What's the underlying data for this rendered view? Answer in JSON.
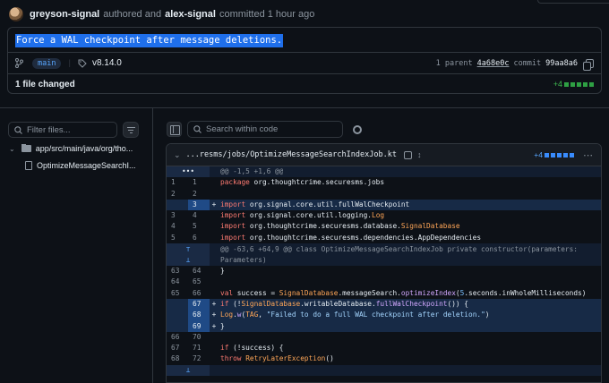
{
  "commit": {
    "author": "greyson-signal",
    "authored_text": "authored and",
    "committer": "alex-signal",
    "committed_text": "committed 1 hour ago",
    "message": "Force a WAL checkpoint after message deletions.",
    "branch": "main",
    "tag": "v8.14.0",
    "parent_text": "1 parent",
    "parent_sha": "4a68e0c",
    "commit_text": "commit",
    "commit_sha": "99aa8a6",
    "files_changed": "1 file changed",
    "additions": "+4"
  },
  "sidebar": {
    "filter_placeholder": "Filter files...",
    "dir_path": "app/src/main/java/org/tho...",
    "file_name": "OptimizeMessageSearchI..."
  },
  "toolbar": {
    "search_placeholder": "Search within code"
  },
  "diff": {
    "file_path": "...resms/jobs/OptimizeMessageSearchIndexJob.kt",
    "additions": "+4",
    "hunk1": "@@ -1,5 +1,6 @@",
    "hunk2_line1": "@@ -63,6 +64,9 @@ class OptimizeMessageSearchIndexJob private constructor(parameters:",
    "hunk2_line2": "Parameters)",
    "lines1": [
      {
        "old": "1",
        "new": "1",
        "sign": "",
        "type": "ctx",
        "code": "package org.thoughtcrime.securesms.jobs"
      },
      {
        "old": "2",
        "new": "2",
        "sign": "",
        "type": "ctx",
        "code": ""
      },
      {
        "old": "",
        "new": "3",
        "sign": "+",
        "type": "add",
        "code": "import org.signal.core.util.fullWalCheckpoint"
      },
      {
        "old": "3",
        "new": "4",
        "sign": "",
        "type": "ctx",
        "code": "import org.signal.core.util.logging.Log"
      },
      {
        "old": "4",
        "new": "5",
        "sign": "",
        "type": "ctx",
        "code": "import org.thoughtcrime.securesms.database.SignalDatabase"
      },
      {
        "old": "5",
        "new": "6",
        "sign": "",
        "type": "ctx",
        "code": "import org.thoughtcrime.securesms.dependencies.AppDependencies"
      }
    ],
    "lines2": [
      {
        "old": "63",
        "new": "64",
        "sign": "",
        "type": "ctx",
        "code": "    }"
      },
      {
        "old": "64",
        "new": "65",
        "sign": "",
        "type": "ctx",
        "code": ""
      },
      {
        "old": "65",
        "new": "66",
        "sign": "",
        "type": "ctx",
        "code": "    val success = SignalDatabase.messageSearch.optimizeIndex(5.seconds.inWholeMilliseconds)"
      },
      {
        "old": "",
        "new": "67",
        "sign": "+",
        "type": "add",
        "code": "    if (!SignalDatabase.writableDatabase.fullWalCheckpoint()) {"
      },
      {
        "old": "",
        "new": "68",
        "sign": "+",
        "type": "add",
        "code": "      Log.w(TAG, \"Failed to do a full WAL checkpoint after deletion.\")"
      },
      {
        "old": "",
        "new": "69",
        "sign": "+",
        "type": "add",
        "code": "    }"
      },
      {
        "old": "66",
        "new": "70",
        "sign": "",
        "type": "ctx",
        "code": ""
      },
      {
        "old": "67",
        "new": "71",
        "sign": "",
        "type": "ctx",
        "code": "    if (!success) {"
      },
      {
        "old": "68",
        "new": "72",
        "sign": "",
        "type": "ctx",
        "code": "      throw RetryLaterException()"
      }
    ]
  },
  "colors": {
    "background": "#0d1117",
    "accent": "#58a6ff",
    "addition": "#2ea043",
    "selection": "#1f6feb"
  }
}
